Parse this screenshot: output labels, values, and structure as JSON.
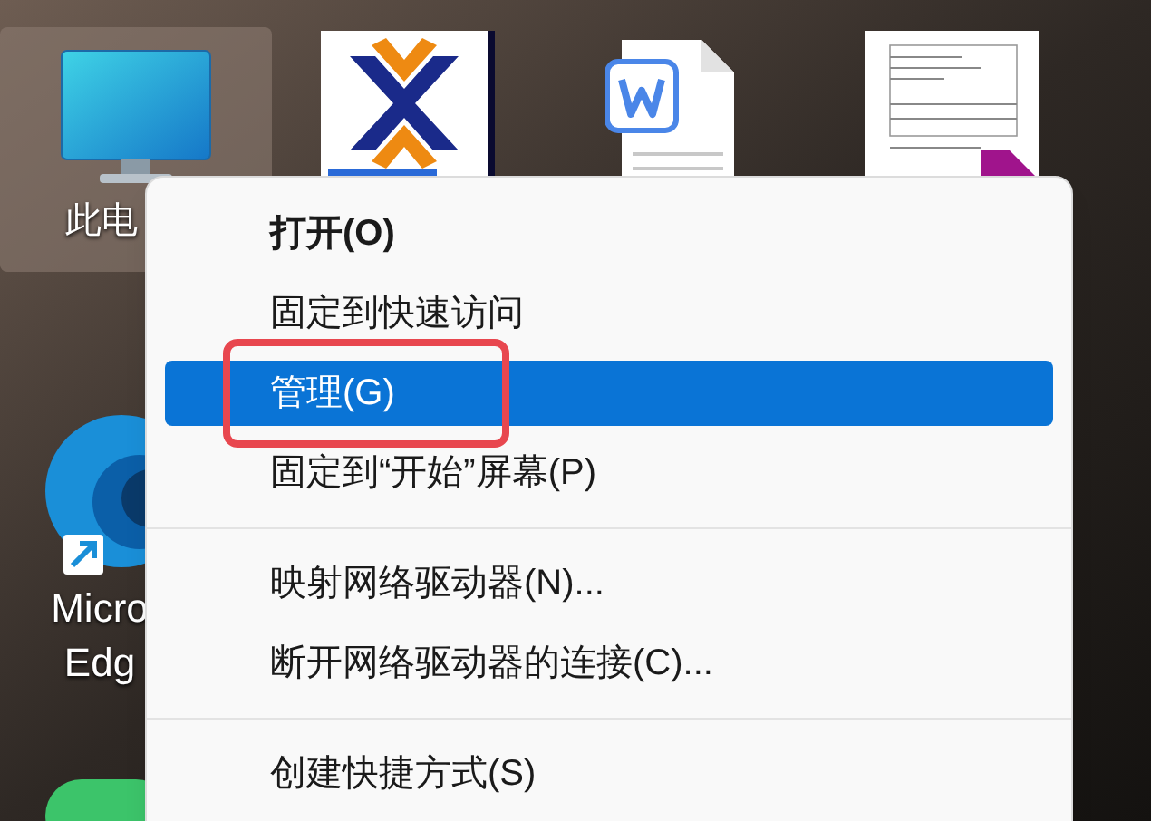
{
  "desktop_icons": [
    {
      "kind": "computer",
      "lines": [
        "此电"
      ],
      "selected": true
    },
    {
      "kind": "logo",
      "selected": false
    },
    {
      "kind": "word",
      "selected": false
    },
    {
      "kind": "document",
      "selected": false
    },
    {
      "kind": "edge",
      "lines": [
        "Micro",
        "Edg"
      ],
      "selected": false
    },
    {
      "kind": "green",
      "selected": false
    }
  ],
  "context_menu": {
    "items": [
      {
        "kind": "item",
        "label": "打开(O)",
        "bold": true,
        "selected": false,
        "annotated": false
      },
      {
        "kind": "item",
        "label": "固定到快速访问",
        "bold": false,
        "selected": false,
        "annotated": false
      },
      {
        "kind": "item",
        "label": "管理(G)",
        "bold": false,
        "selected": true,
        "annotated": true
      },
      {
        "kind": "item",
        "label": "固定到“开始”屏幕(P)",
        "bold": false,
        "selected": false,
        "annotated": false
      },
      {
        "kind": "separator"
      },
      {
        "kind": "item",
        "label": "映射网络驱动器(N)...",
        "bold": false,
        "selected": false,
        "annotated": false
      },
      {
        "kind": "item",
        "label": "断开网络驱动器的连接(C)...",
        "bold": false,
        "selected": false,
        "annotated": false
      },
      {
        "kind": "separator"
      },
      {
        "kind": "item",
        "label": "创建快捷方式(S)",
        "bold": false,
        "selected": false,
        "annotated": false
      }
    ]
  }
}
